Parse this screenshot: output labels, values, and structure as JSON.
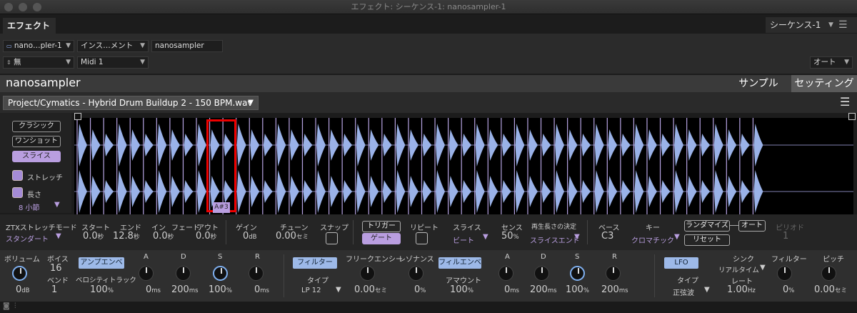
{
  "window": {
    "title": "エフェクト: シーケンス-1: nanosampler-1"
  },
  "tabs": {
    "effect": "エフェクト",
    "sequence": "シーケンス-1"
  },
  "controls": {
    "plugin_select": "nano…pler-1",
    "category_select": "インス…メント",
    "plugin_name": "nanosampler",
    "input_select": "無",
    "midi_select": "Midi 1",
    "auto_select": "オート"
  },
  "sampler": {
    "title": "nanosampler",
    "tab_sample": "サンプル",
    "tab_settings": "セッティング"
  },
  "file": {
    "name": "Project/Cymatics - Hybrid Drum Buildup 2 - 150 BPM.wav"
  },
  "mode": {
    "classic": "クラシック",
    "oneshot": "ワンショット",
    "slice": "スライス",
    "stretch": "ストレッチ",
    "length": "長さ",
    "length_value": "8 小節"
  },
  "waveform": {
    "selected_note": "A#3",
    "slices": 52,
    "highlight_index": 10
  },
  "row1": {
    "ztx_label": "ZTXストレッチモード",
    "ztx_value": "スタンダート",
    "start_label": "スタート",
    "start_val": "0.0",
    "start_unit": "秒",
    "end_label": "エンド",
    "end_val": "12.8",
    "end_unit": "秒",
    "fadein_label": "イン",
    "fadein_val": "0.0",
    "fadein_unit": "秒",
    "fade_label": "フェード",
    "fadeout_label": "アウト",
    "fadeout_val": "0.0",
    "fadeout_unit": "秒",
    "gain_label": "ゲイン",
    "gain_val": "0",
    "gain_unit": "dB",
    "tune_label": "チューン",
    "tune_val": "0.00",
    "tune_unit": "セミ",
    "snap_label": "スナップ",
    "trigger": "トリガー",
    "gate": "ゲート",
    "repeat_label": "リピート",
    "slice_label": "スライス",
    "slice_value": "ビート",
    "sense_label": "センス",
    "sense_val": "50",
    "sense_unit": "%",
    "length_label": "再生長さの決定",
    "length_value": "スライスエンド",
    "base_label": "ベース",
    "base_value": "C3",
    "key_label": "キー",
    "key_value": "クロマチック",
    "randomize": "ランダマイズ",
    "auto": "オート",
    "reset": "リセット",
    "period_label": "ピリオド",
    "period_value": "1"
  },
  "row2": {
    "volume_label": "ボリューム",
    "volume_val": "0",
    "volume_unit": "dB",
    "voice_label": "ボイス",
    "voice_val": "16",
    "bend_label": "ベンド",
    "bend_val": "1",
    "ampenv": "アンプエンベ",
    "velocity_label": "ベロシティトラック",
    "velocity_val": "100",
    "velocity_unit": "%",
    "a1_label": "A",
    "a1_val": "0",
    "a1_unit": "ms",
    "d1_label": "D",
    "d1_val": "200",
    "d1_unit": "ms",
    "s1_label": "S",
    "s1_val": "100",
    "s1_unit": "%",
    "r1_label": "R",
    "r1_val": "0",
    "r1_unit": "ms",
    "filter": "フィルター",
    "type_label": "タイプ",
    "type_value": "LP 12",
    "freq_label": "フリークエンシー",
    "freq_val": "0.00",
    "freq_unit": "セミ",
    "reso_label": "レゾナンス",
    "reso_val": "0",
    "reso_unit": "%",
    "filenv": "フィルエンベ",
    "amount_label": "アマウント",
    "amount_val": "100",
    "amount_unit": "%",
    "a2_label": "A",
    "a2_val": "0",
    "a2_unit": "ms",
    "d2_label": "D",
    "d2_val": "200",
    "d2_unit": "ms",
    "s2_label": "S",
    "s2_val": "100",
    "s2_unit": "%",
    "r2_label": "R",
    "r2_val": "200",
    "r2_unit": "ms",
    "lfo": "LFO",
    "lfo_type_label": "タイプ",
    "lfo_type_value": "正弦波",
    "sync_label": "シンク",
    "sync_value": "リアルタイム",
    "rate_label": "レート",
    "rate_val": "1.00",
    "rate_unit": "Hz",
    "lfo_filter_label": "フィルター",
    "lfo_filter_val": "0",
    "lfo_filter_unit": "%",
    "pitch_label": "ピッチ",
    "pitch_val": "0.00",
    "pitch_unit": "セミ"
  }
}
